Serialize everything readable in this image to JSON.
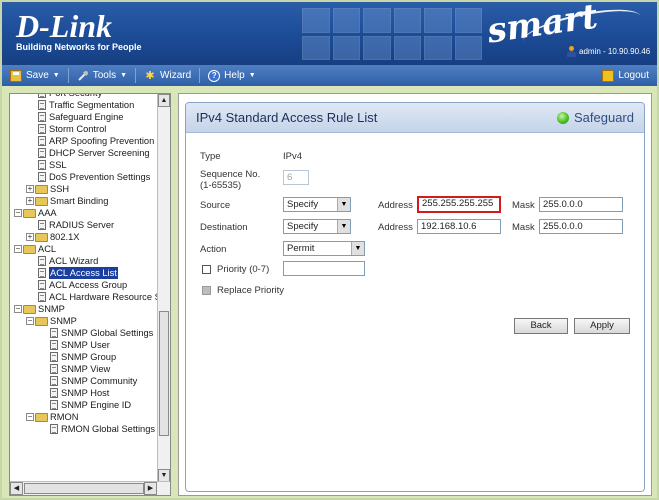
{
  "header": {
    "brand": "D-Link",
    "tagline": "Building Networks for People",
    "product_mark": "smart",
    "session": "admin - 10.90.90.46"
  },
  "toolbar": {
    "save": "Save",
    "tools": "Tools",
    "wizard": "Wizard",
    "help": "Help",
    "logout": "Logout"
  },
  "tree": {
    "items": [
      {
        "label": "Port Security",
        "indent": 2,
        "kind": "page"
      },
      {
        "label": "Traffic Segmentation",
        "indent": 2,
        "kind": "page"
      },
      {
        "label": "Safeguard Engine",
        "indent": 2,
        "kind": "page"
      },
      {
        "label": "Storm Control",
        "indent": 2,
        "kind": "page"
      },
      {
        "label": "ARP Spoofing Prevention",
        "indent": 2,
        "kind": "page"
      },
      {
        "label": "DHCP Server Screening",
        "indent": 2,
        "kind": "page"
      },
      {
        "label": "SSL",
        "indent": 2,
        "kind": "page"
      },
      {
        "label": "DoS Prevention Settings",
        "indent": 2,
        "kind": "page"
      },
      {
        "label": "SSH",
        "indent": 1,
        "kind": "folder"
      },
      {
        "label": "Smart Binding",
        "indent": 1,
        "kind": "folder"
      },
      {
        "label": "AAA",
        "indent": 0,
        "kind": "folder-open"
      },
      {
        "label": "RADIUS Server",
        "indent": 2,
        "kind": "page"
      },
      {
        "label": "802.1X",
        "indent": 1,
        "kind": "folder"
      },
      {
        "label": "ACL",
        "indent": 0,
        "kind": "folder-open"
      },
      {
        "label": "ACL Wizard",
        "indent": 2,
        "kind": "page"
      },
      {
        "label": "ACL Access List",
        "indent": 2,
        "kind": "page",
        "selected": true
      },
      {
        "label": "ACL Access Group",
        "indent": 2,
        "kind": "page"
      },
      {
        "label": "ACL Hardware Resource St",
        "indent": 2,
        "kind": "page"
      },
      {
        "label": "SNMP",
        "indent": 0,
        "kind": "folder-open"
      },
      {
        "label": "SNMP",
        "indent": 1,
        "kind": "folder-open"
      },
      {
        "label": "SNMP Global Settings",
        "indent": 3,
        "kind": "page"
      },
      {
        "label": "SNMP User",
        "indent": 3,
        "kind": "page"
      },
      {
        "label": "SNMP Group",
        "indent": 3,
        "kind": "page"
      },
      {
        "label": "SNMP View",
        "indent": 3,
        "kind": "page"
      },
      {
        "label": "SNMP Community",
        "indent": 3,
        "kind": "page"
      },
      {
        "label": "SNMP Host",
        "indent": 3,
        "kind": "page"
      },
      {
        "label": "SNMP Engine ID",
        "indent": 3,
        "kind": "page"
      },
      {
        "label": "RMON",
        "indent": 1,
        "kind": "folder-open"
      },
      {
        "label": "RMON Global Settings",
        "indent": 3,
        "kind": "page"
      }
    ]
  },
  "panel": {
    "title": "IPv4 Standard Access Rule List",
    "safeguard": "Safeguard",
    "type_label": "Type",
    "type_value": "IPv4",
    "seq_label": "Sequence No. (1-65535)",
    "seq_value": "6",
    "source_label": "Source",
    "source_select": "Specify",
    "source_addr_label": "Address",
    "source_addr": "255.255.255.255",
    "source_mask_label": "Mask",
    "source_mask": "255.0.0.0",
    "dest_label": "Destination",
    "dest_select": "Specify",
    "dest_addr_label": "Address",
    "dest_addr": "192.168.10.6",
    "dest_mask_label": "Mask",
    "dest_mask": "255.0.0.0",
    "action_label": "Action",
    "action_select": "Permit",
    "priority_label": "Priority (0-7)",
    "priority_value": "",
    "replace_priority_label": "Replace Priority",
    "back": "Back",
    "apply": "Apply"
  }
}
